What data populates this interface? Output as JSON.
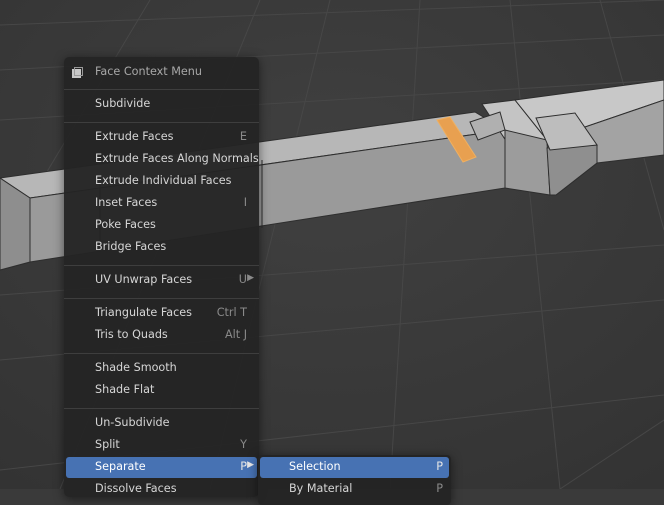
{
  "menu": {
    "title": "Face Context Menu",
    "title_icon": "face-select-icon",
    "groups": [
      [
        {
          "label": "Subdivide",
          "shortcut": "",
          "submenu": false
        }
      ],
      [
        {
          "label": "Extrude Faces",
          "shortcut": "E",
          "submenu": false
        },
        {
          "label": "Extrude Faces Along Normals",
          "shortcut": "",
          "submenu": false
        },
        {
          "label": "Extrude Individual Faces",
          "shortcut": "",
          "submenu": false
        },
        {
          "label": "Inset Faces",
          "shortcut": "I",
          "submenu": false
        },
        {
          "label": "Poke Faces",
          "shortcut": "",
          "submenu": false
        },
        {
          "label": "Bridge Faces",
          "shortcut": "",
          "submenu": false
        }
      ],
      [
        {
          "label": "UV Unwrap Faces",
          "shortcut": "U",
          "submenu": true
        }
      ],
      [
        {
          "label": "Triangulate Faces",
          "shortcut": "Ctrl T",
          "submenu": false
        },
        {
          "label": "Tris to Quads",
          "shortcut": "Alt J",
          "submenu": false
        }
      ],
      [
        {
          "label": "Shade Smooth",
          "shortcut": "",
          "submenu": false
        },
        {
          "label": "Shade Flat",
          "shortcut": "",
          "submenu": false
        }
      ],
      [
        {
          "label": "Un-Subdivide",
          "shortcut": "",
          "submenu": false
        },
        {
          "label": "Split",
          "shortcut": "Y",
          "submenu": false
        },
        {
          "label": "Separate",
          "shortcut": "P",
          "submenu": true,
          "active": true
        },
        {
          "label": "Dissolve Faces",
          "shortcut": "",
          "submenu": false
        }
      ]
    ]
  },
  "separate_submenu": {
    "items": [
      {
        "label": "Selection",
        "shortcut": "P",
        "active": true
      },
      {
        "label": "By Material",
        "shortcut": "P"
      }
    ]
  },
  "colors": {
    "viewport_bg": "#3a3a3a",
    "menu_bg": "#242424",
    "highlight": "#4772b3",
    "selected_face": "#e8a050"
  }
}
